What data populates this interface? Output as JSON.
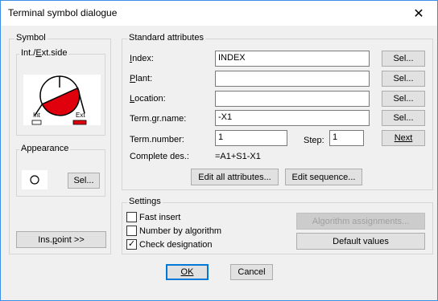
{
  "window": {
    "title": "Terminal symbol dialogue"
  },
  "symbol": {
    "label": "Symbol",
    "side_label": "Int./Ext.side",
    "side_label_u": "E",
    "preview_int": "Int",
    "preview_ext": "Ext",
    "appearance_label": "Appearance",
    "sel_label": "Sel...",
    "ins_point_label": "Ins.point >>",
    "ins_point_u": "p"
  },
  "attributes": {
    "label": "Standard attributes",
    "rows": [
      {
        "label": "Index:",
        "u": "I",
        "value": "INDEX",
        "sel": "Sel..."
      },
      {
        "label": "Plant:",
        "u": "P",
        "value": "",
        "sel": "Sel..."
      },
      {
        "label": "Location:",
        "u": "L",
        "value": "",
        "sel": "Sel..."
      },
      {
        "label": "Term.gr.name:",
        "u": "g",
        "value": "-X1",
        "sel": "Sel..."
      }
    ],
    "term_number_label": "Term.number:",
    "term_number_value": "1",
    "step_label": "Step:",
    "step_value": "1",
    "next_label": "Next",
    "complete_label": "Complete des.:",
    "complete_value": "=A1+S1-X1",
    "edit_all_label": "Edit all attributes...",
    "edit_seq_label": "Edit sequence..."
  },
  "settings": {
    "label": "Settings",
    "fast_insert": {
      "label": "Fast insert",
      "checked": false
    },
    "number_by_algorithm": {
      "label": "Number by algorithm",
      "checked": false
    },
    "check_designation": {
      "label": "Check designation",
      "checked": true
    },
    "algorithm_label": "Algorithm assignments...",
    "default_values_label": "Default values"
  },
  "footer": {
    "ok_label": "OK",
    "cancel_label": "Cancel"
  },
  "colors": {
    "accent": "#0078d7",
    "symbol_fill": "#e0000d",
    "window_border": "#3c8ee6"
  }
}
